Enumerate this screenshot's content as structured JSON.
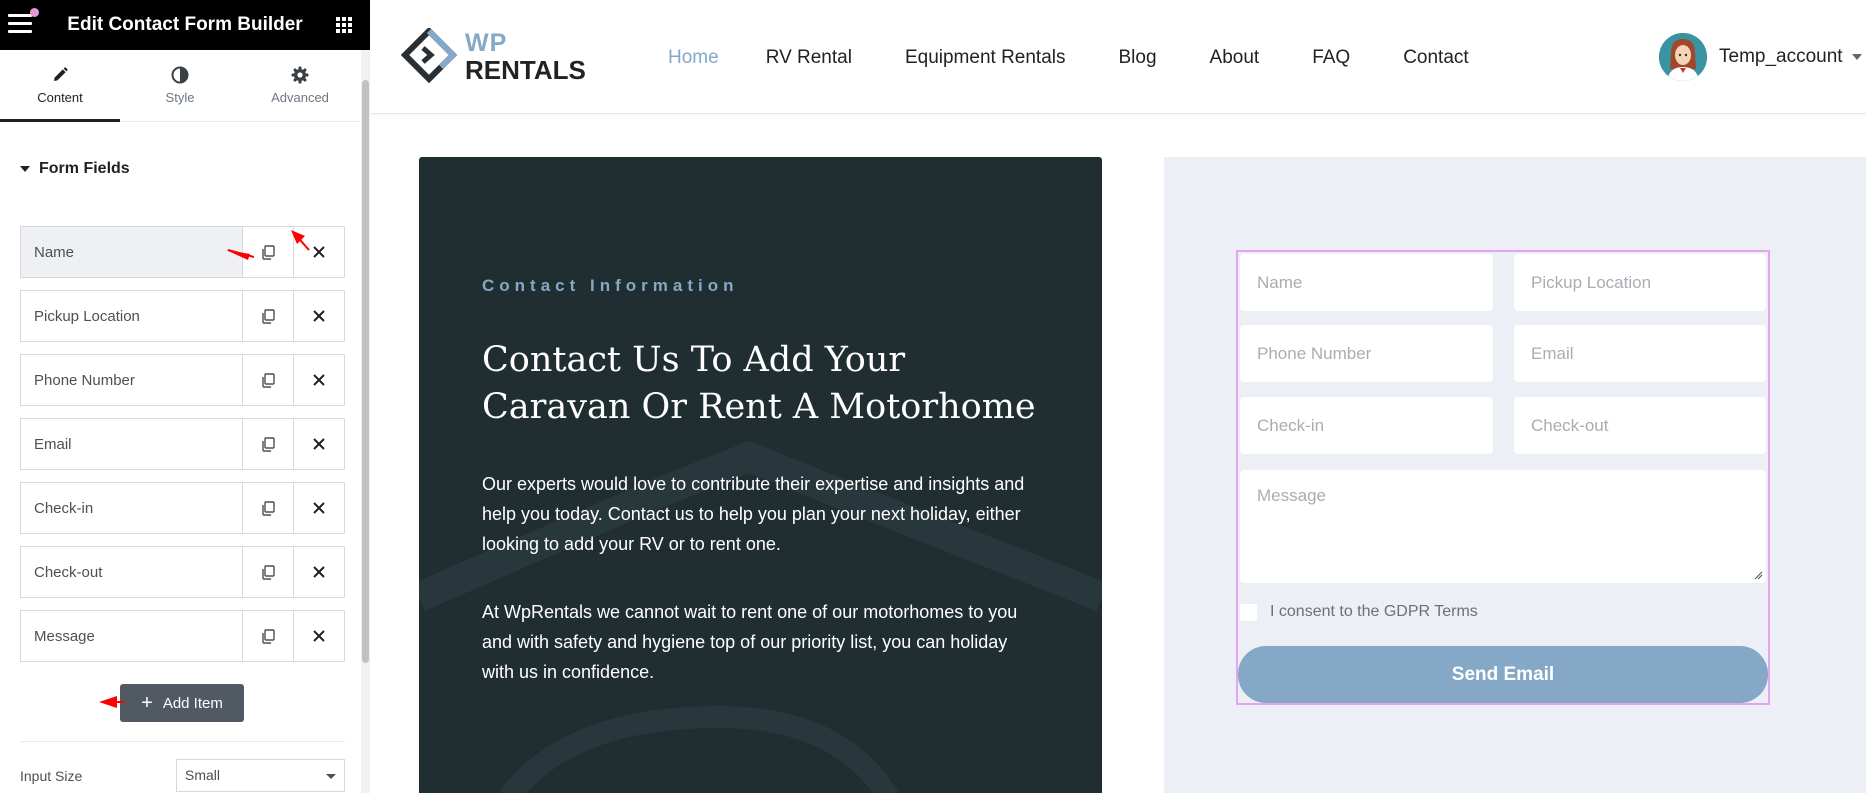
{
  "editor": {
    "title": "Edit Contact Form Builder",
    "tabs": [
      {
        "label": "Content",
        "icon": "pencil-icon"
      },
      {
        "label": "Style",
        "icon": "half-circle-icon"
      },
      {
        "label": "Advanced",
        "icon": "gear-icon"
      }
    ],
    "section_title": "Form Fields",
    "fields": [
      {
        "label": "Name"
      },
      {
        "label": "Pickup Location"
      },
      {
        "label": "Phone Number"
      },
      {
        "label": "Email"
      },
      {
        "label": "Check-in"
      },
      {
        "label": "Check-out"
      },
      {
        "label": "Message"
      }
    ],
    "add_item_label": "Add Item",
    "input_size_label": "Input Size",
    "input_size_value": "Small"
  },
  "site": {
    "logo": {
      "line1": "WP",
      "line2": "RENTALS"
    },
    "nav": [
      "Home",
      "RV Rental",
      "Equipment Rentals",
      "Blog",
      "About",
      "FAQ",
      "Contact"
    ],
    "active_nav": "Home",
    "account_name": "Temp_account",
    "contact": {
      "eyebrow": "Contact Information",
      "headline": "Contact Us To Add Your Caravan Or Rent A Motorhome",
      "paragraph1": "Our experts would love to contribute their expertise and insights and help you today. Contact us to help you plan your next holiday, either looking to add your RV or to rent one.",
      "paragraph2": "At WpRentals we cannot wait to rent one of our motorhomes to you and with safety and hygiene top of our priority list, you can holiday with us in confidence."
    },
    "form": {
      "placeholders": {
        "name": "Name",
        "pickup": "Pickup Location",
        "phone": "Phone Number",
        "email": "Email",
        "checkin": "Check-in",
        "checkout": "Check-out",
        "message": "Message"
      },
      "consent": "I consent to the GDPR Terms",
      "submit": "Send Email"
    }
  },
  "colors": {
    "accent": "#84a8c6",
    "dark_card": "#202e31",
    "form_bg": "#eceff5",
    "selection_outline": "#e5a4f0",
    "annotation": "#ff0000"
  }
}
